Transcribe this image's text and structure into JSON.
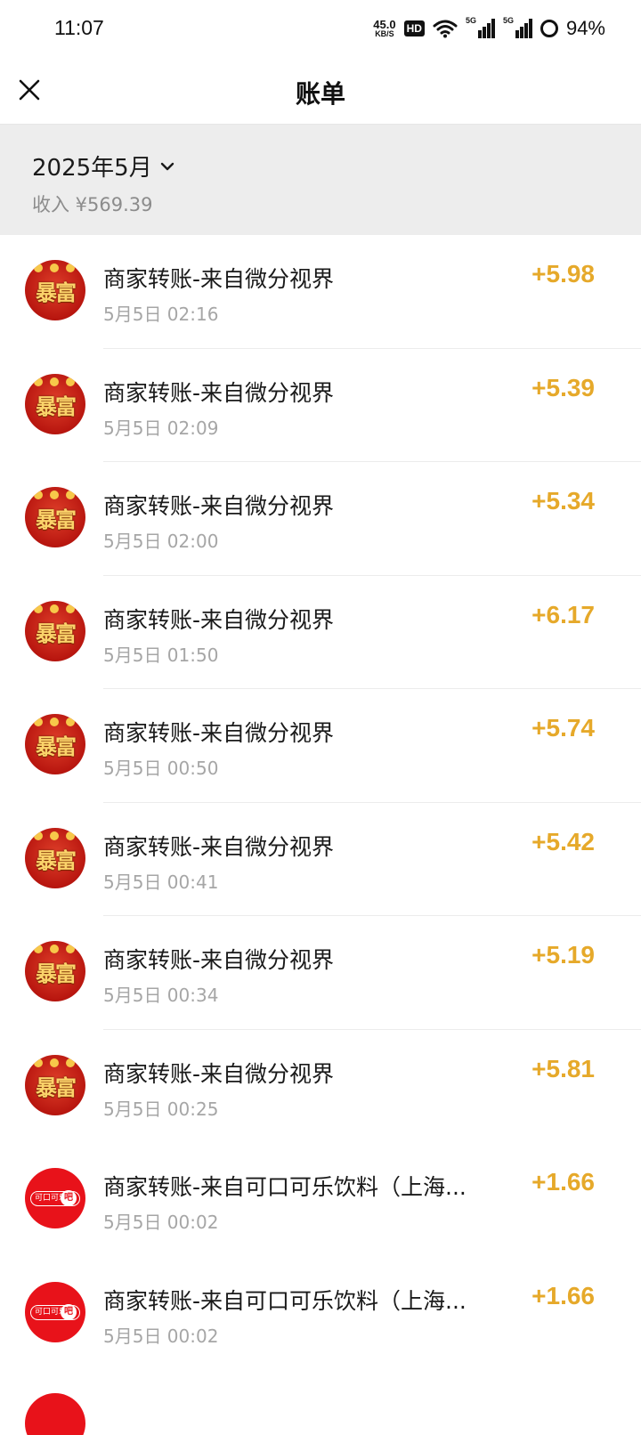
{
  "status_bar": {
    "time": "11:07",
    "net_speed_value": "45.0",
    "net_speed_unit": "KB/S",
    "hd_label": "HD",
    "sim1_label": "5G",
    "sim2_label": "5G",
    "battery": "94%",
    "icons": [
      "wifi-icon",
      "signal-icon",
      "battery-icon"
    ]
  },
  "nav": {
    "title": "账单",
    "close_icon": "close-icon"
  },
  "summary": {
    "month": "2025年5月",
    "income": "收入 ¥569.39"
  },
  "colors": {
    "amount": "#e6a92a",
    "header_bg": "#ededed",
    "coke_red": "#e8121a"
  },
  "transactions": [
    {
      "avatar": "fortune-avatar",
      "avatar_text": "暴富",
      "title": "商家转账-来自微分视界",
      "time": "5月5日 02:16",
      "amount": "+5.98"
    },
    {
      "avatar": "fortune-avatar",
      "avatar_text": "暴富",
      "title": "商家转账-来自微分视界",
      "time": "5月5日 02:09",
      "amount": "+5.39"
    },
    {
      "avatar": "fortune-avatar",
      "avatar_text": "暴富",
      "title": "商家转账-来自微分视界",
      "time": "5月5日 02:00",
      "amount": "+5.34"
    },
    {
      "avatar": "fortune-avatar",
      "avatar_text": "暴富",
      "title": "商家转账-来自微分视界",
      "time": "5月5日 01:50",
      "amount": "+6.17"
    },
    {
      "avatar": "fortune-avatar",
      "avatar_text": "暴富",
      "title": "商家转账-来自微分视界",
      "time": "5月5日 00:50",
      "amount": "+5.74"
    },
    {
      "avatar": "fortune-avatar",
      "avatar_text": "暴富",
      "title": "商家转账-来自微分视界",
      "time": "5月5日 00:41",
      "amount": "+5.42"
    },
    {
      "avatar": "fortune-avatar",
      "avatar_text": "暴富",
      "title": "商家转账-来自微分视界",
      "time": "5月5日 00:34",
      "amount": "+5.19"
    },
    {
      "avatar": "fortune-avatar",
      "avatar_text": "暴富",
      "title": "商家转账-来自微分视界",
      "time": "5月5日 00:25",
      "amount": "+5.81"
    },
    {
      "avatar": "coke-avatar",
      "avatar_text": "可口可乐",
      "avatar_badge": "吧",
      "title": "商家转账-来自可口可乐饮料（上海...",
      "time": "5月5日 00:02",
      "amount": "+1.66"
    },
    {
      "avatar": "coke-avatar",
      "avatar_text": "可口可乐",
      "avatar_badge": "吧",
      "title": "商家转账-来自可口可乐饮料（上海...",
      "time": "5月5日 00:02",
      "amount": "+1.66"
    }
  ]
}
